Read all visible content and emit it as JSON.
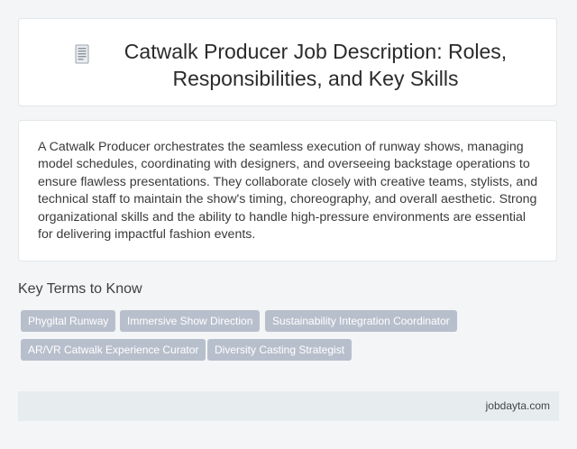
{
  "header": {
    "icon": "document-icon",
    "title": "Catwalk Producer Job Description: Roles, Responsibilities, and Key Skills"
  },
  "description": {
    "text": "A Catwalk Producer orchestrates the seamless execution of runway shows, managing model schedules, coordinating with designers, and overseeing backstage operations to ensure flawless presentations. They collaborate closely with creative teams, stylists, and technical staff to maintain the show's timing, choreography, and overall aesthetic. Strong organizational skills and the ability to handle high-pressure environments are essential for delivering impactful fashion events."
  },
  "key_terms": {
    "heading": "Key Terms to Know",
    "tags": [
      "Phygital Runway",
      "Immersive Show Direction",
      "Sustainability Integration Coordinator",
      "AR/VR Catwalk Experience Curator",
      "Diversity Casting Strategist"
    ]
  },
  "footer": {
    "site": "jobdayta.com"
  },
  "colors": {
    "tag_background": "#b8bfcc",
    "footer_background": "#e7edee",
    "page_background": "#f3f5f6"
  }
}
